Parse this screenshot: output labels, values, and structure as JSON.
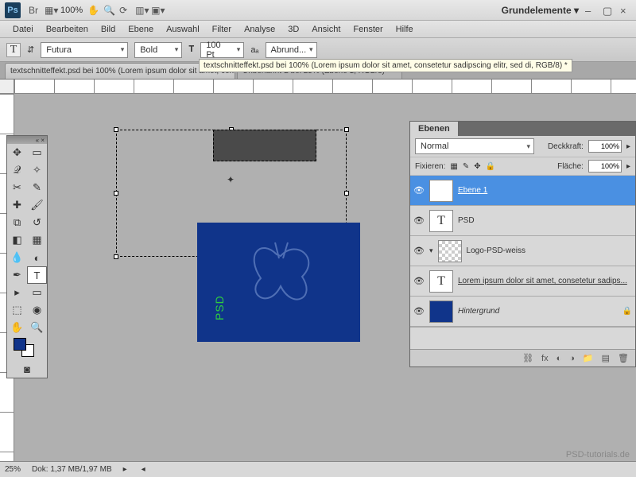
{
  "titlebar": {
    "logo": "Ps",
    "zoom_pct": "100%",
    "workspace": "Grundelemente ▾"
  },
  "menu": [
    "Datei",
    "Bearbeiten",
    "Bild",
    "Ebene",
    "Auswahl",
    "Filter",
    "Analyse",
    "3D",
    "Ansicht",
    "Fenster",
    "Hilfe"
  ],
  "options": {
    "font": "Futura",
    "weight": "Bold",
    "size": "100 Pt",
    "aa": "Abrund...",
    "tooltip": "textschnitteffekt.psd bei 100% (Lorem ipsum dolor sit amet, consetetur sadipscing elitr, sed di, RGB/8) *"
  },
  "tabs": [
    {
      "label": "textschnitteffekt.psd bei 100% (Lorem ipsum dolor sit amet, consetetu... ×",
      "active": true
    },
    {
      "label": "Unbenannt-2 bei 25% (Ebene 1, RGB/8) *  ×",
      "active": false
    }
  ],
  "canvas": {
    "psd_text": "PSD"
  },
  "layers_panel": {
    "title": "Ebenen",
    "blend": "Normal",
    "opacity_label": "Deckkraft:",
    "opacity_val": "100%",
    "lock_label": "Fixieren:",
    "fill_label": "Fläche:",
    "fill_val": "100%",
    "layers": [
      {
        "name": "Ebene 1",
        "thumb": "T",
        "selected": true
      },
      {
        "name": "PSD",
        "thumb": "T"
      },
      {
        "name": "Logo-PSD-weiss",
        "thumb": "checker"
      },
      {
        "name": "Lorem ipsum dolor sit amet, consetetur sadips...",
        "thumb": "T"
      },
      {
        "name": "Hintergrund",
        "thumb": "blue",
        "locked": true
      }
    ]
  },
  "status": {
    "zoom": "25%",
    "doc": "Dok: 1,37 MB/1,97 MB"
  },
  "watermark": "PSD-tutorials.de"
}
